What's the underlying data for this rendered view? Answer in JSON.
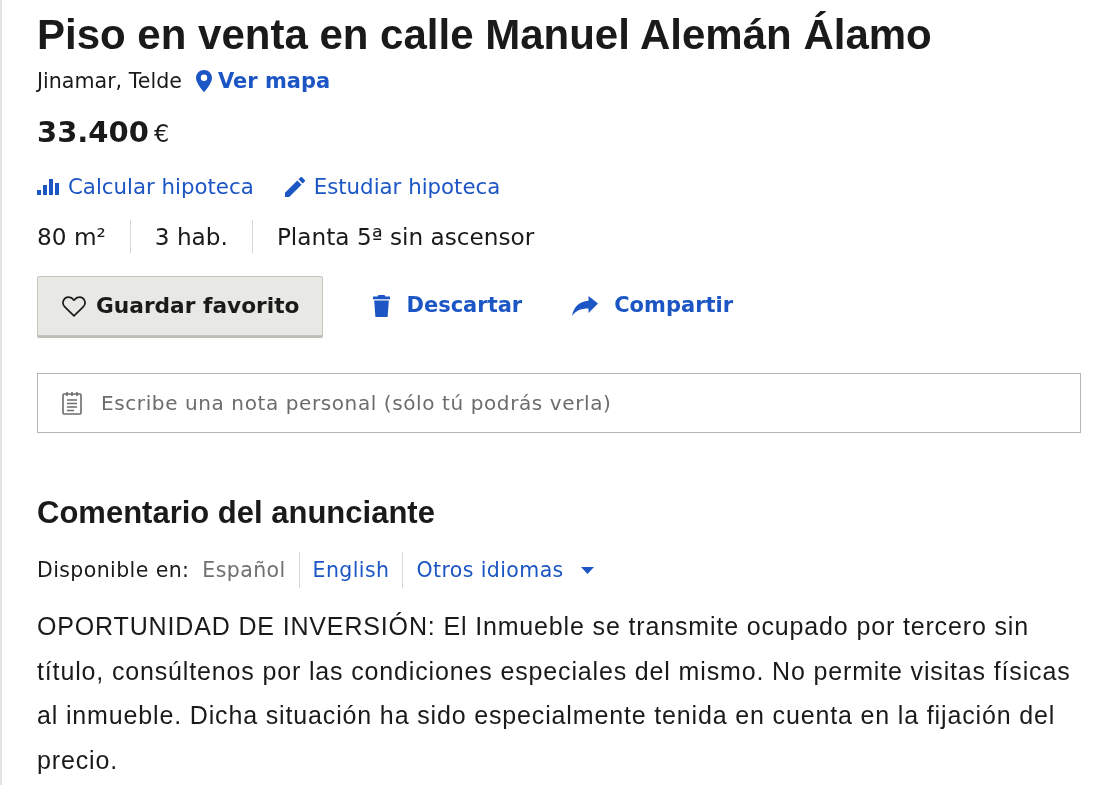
{
  "title": "Piso en venta en calle Manuel Alemán Álamo",
  "location": {
    "text": "Jinamar, Telde",
    "map_link": "Ver mapa"
  },
  "price": {
    "amount": "33.400",
    "currency": "€"
  },
  "mortgage_links": [
    {
      "kind": "calculate",
      "label": "Calcular hipoteca"
    },
    {
      "kind": "study",
      "label": "Estudiar hipoteca"
    }
  ],
  "features": [
    "80 m²",
    "3 hab.",
    "Planta 5ª sin ascensor"
  ],
  "actions": [
    {
      "kind": "favorite",
      "label": "Guardar favorito"
    },
    {
      "kind": "discard",
      "label": "Descartar"
    },
    {
      "kind": "share",
      "label": "Compartir"
    }
  ],
  "note": {
    "placeholder": "Escribe una nota personal (sólo tú podrás verla)"
  },
  "comment": {
    "heading": "Comentario del anunciante",
    "languages_label": "Disponible en:",
    "languages": [
      {
        "kind": "option",
        "label": "Español",
        "selected": true
      },
      {
        "kind": "option",
        "label": "English",
        "selected": false
      },
      {
        "kind": "dropdown",
        "label": "Otros idiomas",
        "selected": false
      }
    ],
    "text": "OPORTUNIDAD DE INVERSIÓN: El Inmueble se transmite ocupado por tercero sin título, consúltenos por las condiciones especiales del mismo. No permite visitas físicas al inmueble. Dicha situación ha sido especialmente tenida en cuenta en la fijación del precio."
  }
}
